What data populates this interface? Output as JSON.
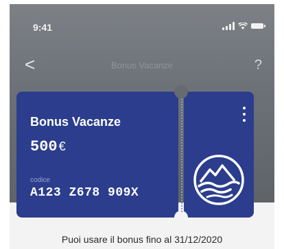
{
  "status_bar": {
    "time": "9:41"
  },
  "nav": {
    "back_glyph": "<",
    "title": "Bonus Vacanze",
    "help_glyph": "?"
  },
  "voucher": {
    "title": "Bonus Vacanze",
    "amount": "500",
    "currency": "€",
    "code_label": "codice",
    "code": "A123 Z678 909X",
    "logo_icon": "mountain-wave-icon",
    "card_color": "#2b3d8c"
  },
  "validity_text": "Puoi usare il bonus fino al 31/12/2020",
  "icons": {
    "signal": "signal-icon",
    "wifi": "wifi-icon",
    "battery": "battery-icon",
    "menu": "more-vertical-icon"
  }
}
